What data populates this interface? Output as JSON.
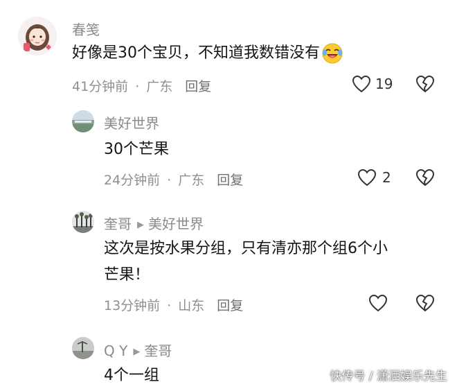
{
  "comments": [
    {
      "username": "春笺",
      "content": "好像是30个宝贝，不知道我数错没有",
      "emoji_icon": "laughing-crying-emoji",
      "time": "41分钟前",
      "location": "广东",
      "reply_label": "回复",
      "likes": "19"
    },
    {
      "username": "美好世界",
      "content": "30个芒果",
      "time": "24分钟前",
      "location": "广东",
      "reply_label": "回复",
      "likes": "2"
    },
    {
      "username": "奎哥",
      "reply_to": "美好世界",
      "content_line1": "这次是按水果分组，只有清亦那个组6个小",
      "content_line2": "芒果！",
      "time": "13分钟前",
      "location": "山东",
      "reply_label": "回复",
      "likes": ""
    },
    {
      "username": "Q Y",
      "reply_to": "奎哥",
      "content": "4个一组"
    }
  ],
  "separator": "·",
  "icons": {
    "like": "heart-outline-icon",
    "dislike": "broken-heart-icon",
    "reply_arrow": "triangle-right-icon"
  },
  "watermark": "快传号 / 潇洒娱乐先生"
}
